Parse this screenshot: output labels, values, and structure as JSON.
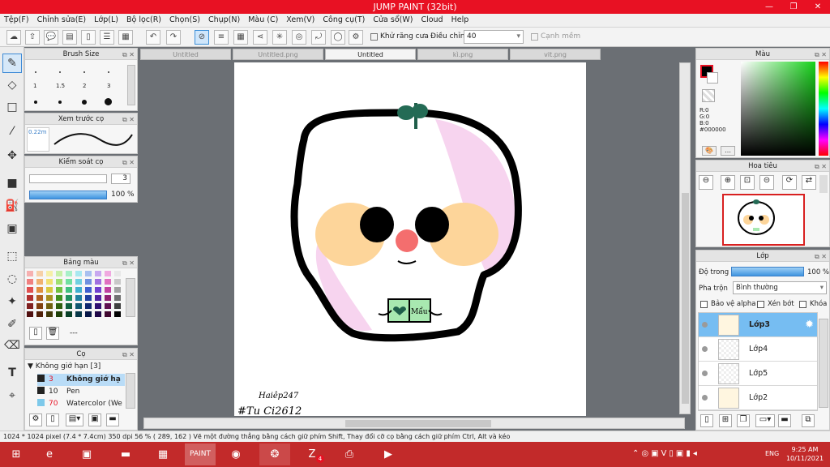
{
  "window": {
    "title": "JUMP PAINT (32bit)"
  },
  "menu": [
    "Tệp(F)",
    "Chỉnh sửa(E)",
    "Lớp(L)",
    "Bộ lọc(R)",
    "Chọn(S)",
    "Chụp(N)",
    "Màu (C)",
    "Xem(V)",
    "Công cụ(T)",
    "Cửa sổ(W)",
    "Cloud",
    "Help"
  ],
  "toolbar": {
    "antialias_label": "Khử răng cưa",
    "adjust_label": "Điều chỉnh",
    "adjust_value": "40",
    "snap_label": "Cạnh mềm"
  },
  "tabs": [
    "Untitled",
    "Untitled.png",
    "Untitled",
    "kì.png",
    "vit.png"
  ],
  "brush_size": {
    "title": "Brush Size",
    "sizes": [
      "1",
      "1.5",
      "2",
      "3"
    ]
  },
  "brush_preview": {
    "title": "Xem trước cọ",
    "size": "0.22m"
  },
  "brush_control": {
    "title": "Kiểm soát cọ",
    "value1": "3",
    "value2": "100 %"
  },
  "palette": {
    "title": "Bảng màu",
    "label": "---"
  },
  "brush_list": {
    "title": "Cọ",
    "group": "Không giớ hạn [3]",
    "items": [
      {
        "size": "3",
        "name": "Không giớ hạ",
        "color": "#e81123",
        "selected": true
      },
      {
        "size": "10",
        "name": "Pen",
        "color": "#222222",
        "selected": false
      },
      {
        "size": "70",
        "name": "Watercolor (We",
        "color": "#e81123",
        "selected": false
      }
    ]
  },
  "color_panel": {
    "title": "Màu",
    "r": "R:0",
    "g": "G:0",
    "b": "B:0",
    "hex": "#000000"
  },
  "navigator": {
    "title": "Hoa tiêu"
  },
  "layers": {
    "title": "Lớp",
    "opacity_label": "Độ trong",
    "opacity_value": "100 %",
    "blend_label": "Pha trộn",
    "blend_value": "Bình thường",
    "protect_alpha": "Bảo vệ alpha",
    "clip": "Xén bớt",
    "lock": "Khóa",
    "items": [
      "Lớp3",
      "Lớp4",
      "Lớp5",
      "Lớp2"
    ]
  },
  "artwork": {
    "book_text": "Mẩu",
    "signature1": "Haiêp247",
    "signature2": "#Tu Ci2612"
  },
  "status": "1024 * 1024 pixel   (7.4 * 7.4cm)   350 dpi   56 %   ( 289, 162 )   Vẽ một đường thẳng bằng cách giữ phím Shift, Thay đổi cỡ cọ bằng cách giữ phím Ctrl, Alt và kéo",
  "taskbar": {
    "lang": "ENG",
    "time": "9:25 AM",
    "date": "10/11/2021",
    "zalo_badge": "4"
  },
  "colors": {
    "title_bar": "#e81123",
    "taskbar": "#c22a2a",
    "accent": "#3c8fd8"
  }
}
